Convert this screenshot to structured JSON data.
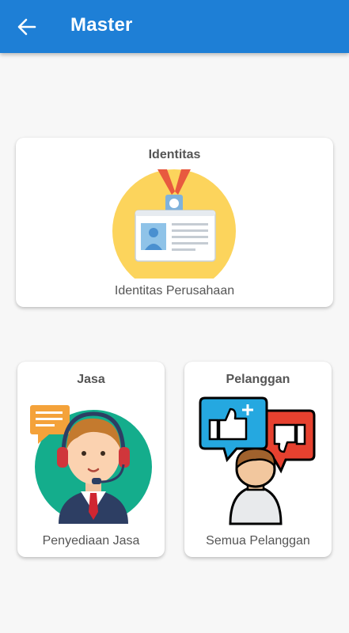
{
  "appbar": {
    "title": "Master",
    "back_icon": "arrow-left-icon",
    "color": "#1e7fd6"
  },
  "cards": {
    "identitas": {
      "title": "Identitas",
      "caption": "Identitas Perusahaan",
      "icon": "id-badge-icon"
    },
    "jasa": {
      "title": "Jasa",
      "caption": "Penyediaan Jasa",
      "icon": "customer-service-agent-icon"
    },
    "pelanggan": {
      "title": "Pelanggan",
      "caption": "Semua Pelanggan",
      "icon": "customer-feedback-icon"
    }
  }
}
